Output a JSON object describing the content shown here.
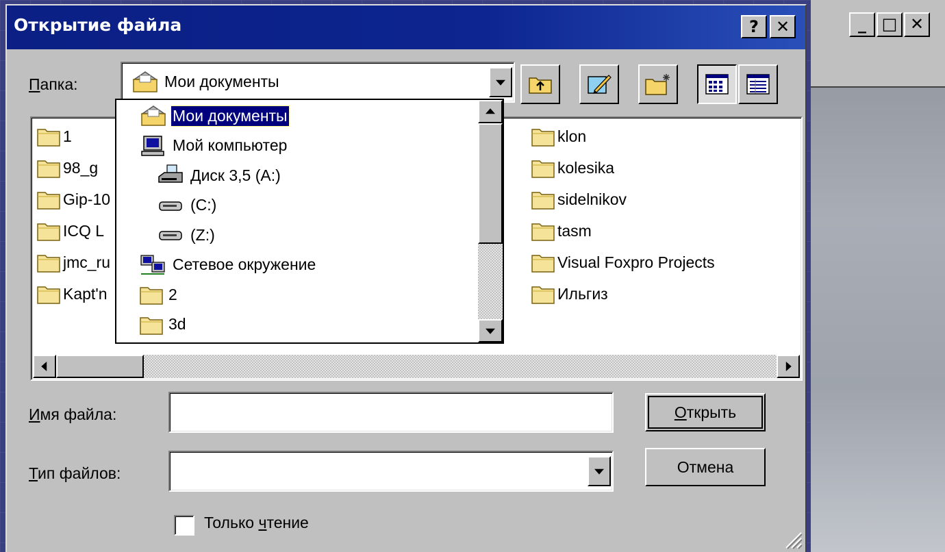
{
  "dialog": {
    "title": "Открытие файла",
    "help_btn": "?",
    "close_btn": "✕",
    "folder_label_first": "П",
    "folder_label_rest": "апка:",
    "folder_value": "Мои документы",
    "file_name_label_first": "И",
    "file_name_label_rest": "мя файла:",
    "file_name_value": "",
    "file_type_label_first": "Т",
    "file_type_label_rest": "ип файлов:",
    "file_type_value": "",
    "readonly_label_a": "Только ",
    "readonly_label_u": "ч",
    "readonly_label_b": "тение",
    "open_btn_first": "О",
    "open_btn_rest": "ткрыть",
    "cancel_btn": "Отмена"
  },
  "files_left": [
    "1",
    "98_g",
    "Gip-10",
    "ICQ L",
    "jmc_ru",
    "Kapt'n"
  ],
  "files_right": [
    "klon",
    "kolesika",
    "sidelnikov",
    "tasm",
    "Visual Foxpro Projects",
    "Ильгиз"
  ],
  "dropdown": [
    "Мои документы",
    "Мой компьютер",
    "Диск 3,5 (A:)",
    "(C:)",
    "(Z:)",
    "Сетевое окружение",
    "2",
    "3d"
  ],
  "bg_window": {
    "min": "_",
    "max": "□",
    "close": "✕"
  }
}
